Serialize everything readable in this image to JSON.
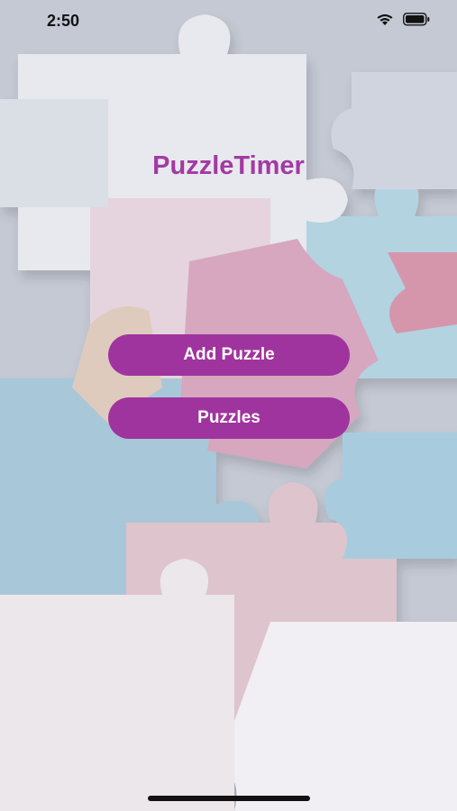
{
  "status_bar": {
    "time": "2:50",
    "wifi_icon": "wifi-icon",
    "battery_icon": "battery-icon"
  },
  "app": {
    "title": "PuzzleTimer"
  },
  "buttons": {
    "add_puzzle_label": "Add Puzzle",
    "puzzles_label": "Puzzles"
  },
  "background": {
    "icon": "jigsaw-puzzle-pieces-photo"
  },
  "colors": {
    "accent": "#a0349e",
    "title": "#a23aa3"
  }
}
